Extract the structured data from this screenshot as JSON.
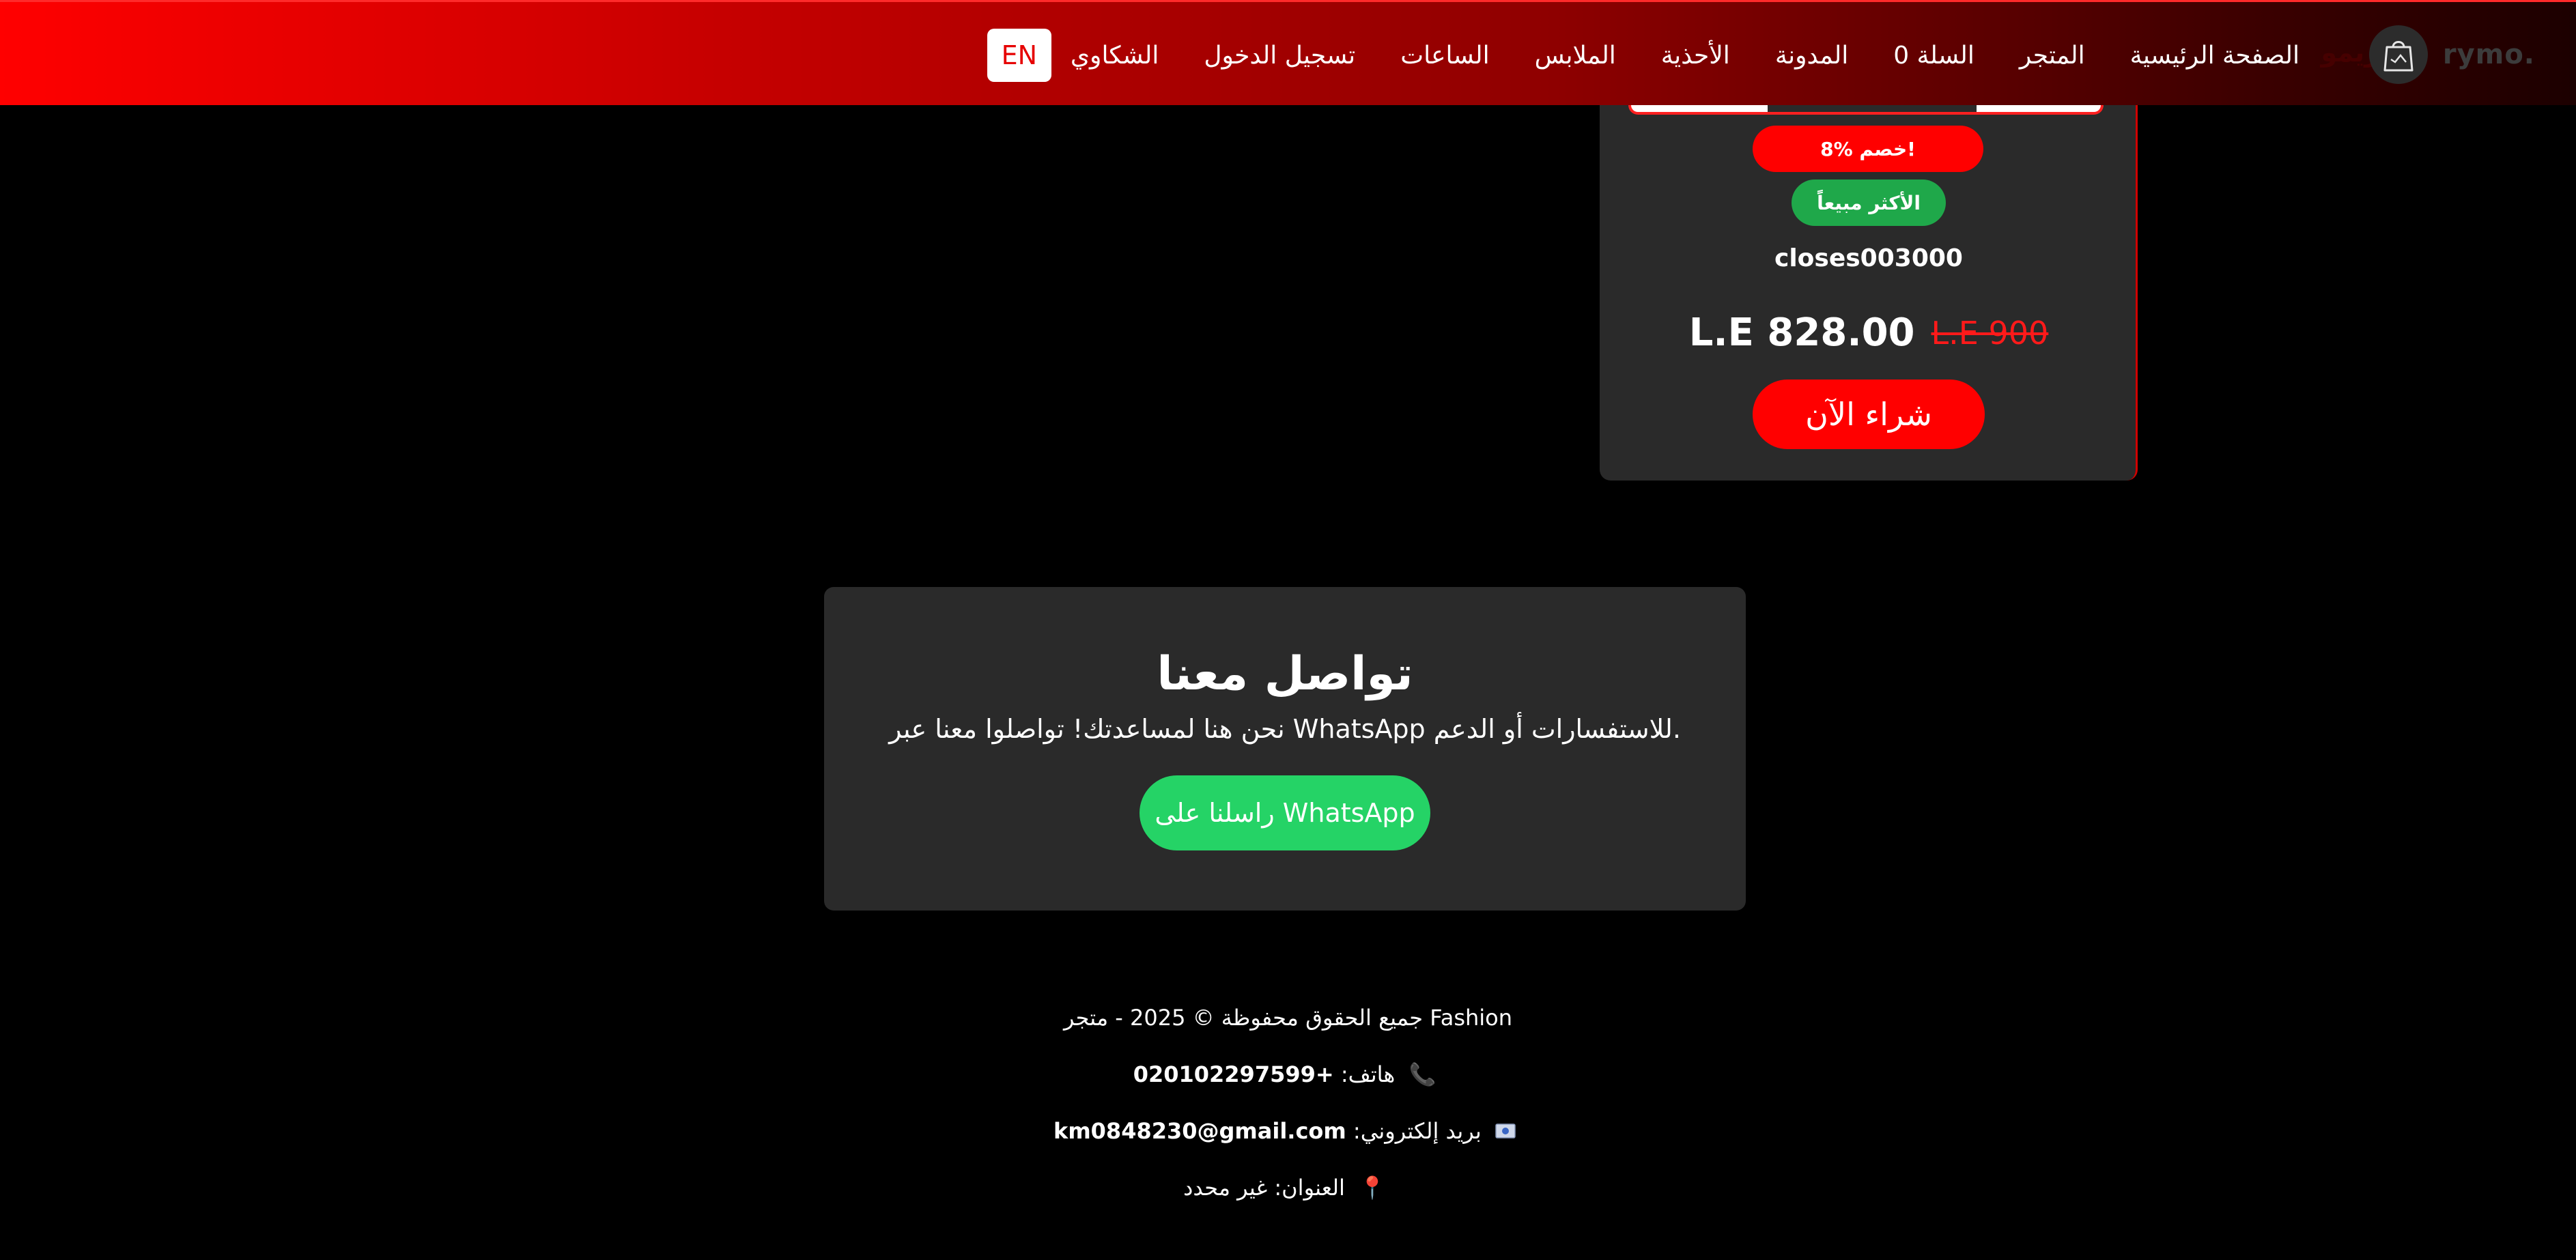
{
  "header": {
    "brand": {
      "name": "rymo.",
      "faded_text": "ريمو"
    },
    "nav": [
      {
        "label": "الصفحة الرئيسية"
      },
      {
        "label": "المتجر"
      },
      {
        "label": "السلة 0"
      },
      {
        "label": "المدونة"
      },
      {
        "label": "الأحذية"
      },
      {
        "label": "الملابس"
      },
      {
        "label": "الساعات"
      },
      {
        "label": "تسجيل الدخول"
      },
      {
        "label": "الشكاوي"
      }
    ],
    "language_button": "EN"
  },
  "product": {
    "discount_badge": "8% خصم!",
    "bestseller_badge": "الأكثر مبيعاً",
    "name": "closes003000",
    "price_current": "L.E 828.00",
    "price_old": "L.E 900",
    "buy_button": "شراء الآن"
  },
  "contact": {
    "title": "تواصل معنا",
    "description": "نحن هنا لمساعدتك! تواصلوا معنا عبر WhatsApp للاستفسارات أو الدعم.",
    "whatsapp_button": "راسلنا على WhatsApp"
  },
  "footer": {
    "copyright": "جميع الحقوق محفوظة © 2025 - متجر Fashion",
    "phone_label": "هاتف:",
    "phone_value": "+020102297599",
    "email_label": "بريد إلكتروني:",
    "email_value": "km0848230@gmail.com",
    "address_label": "العنوان:",
    "address_value": "غير محدد",
    "icons": {
      "phone": "phone-icon",
      "email": "email-icon",
      "address": "pin-icon"
    }
  },
  "colors": {
    "accent": "#ff0000",
    "whatsapp": "#25d366",
    "bestseller": "#1fa84a",
    "card": "#2a2a2a",
    "background": "#000000"
  }
}
